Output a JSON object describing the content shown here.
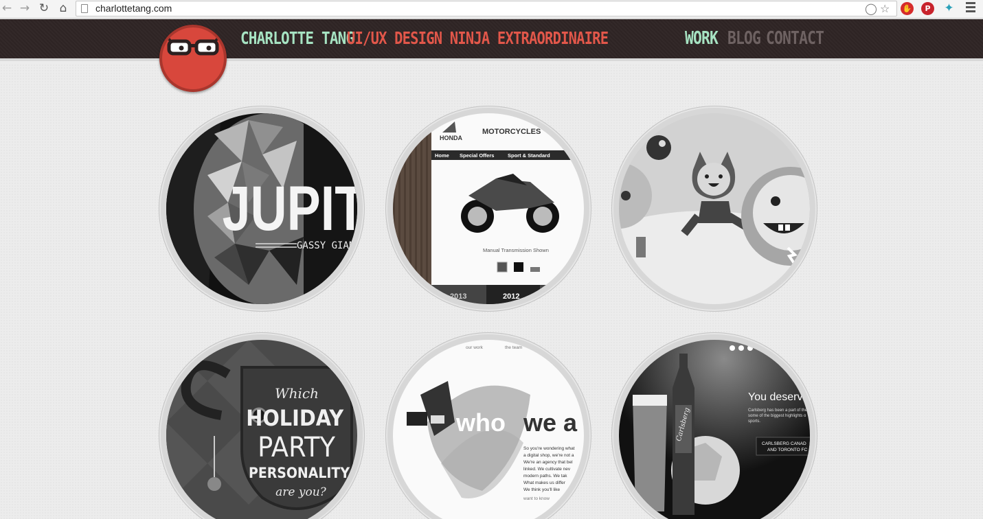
{
  "browser": {
    "url": "charlottetang.com",
    "icons": [
      "back-icon",
      "forward-icon",
      "reload-icon",
      "home-icon",
      "page-icon",
      "shield-icon",
      "star-icon",
      "adblock-icon",
      "pinterest-icon",
      "extension-icon",
      "menu-icon"
    ]
  },
  "header": {
    "brand_name": "CHARLOTTE TANG",
    "tagline": "UI/UX DESIGN NINJA EXTRAORDINAIRE",
    "nav": [
      {
        "label": "WORK",
        "active": true
      },
      {
        "label": "BLOG",
        "active": false
      },
      {
        "label": "CONTACT",
        "active": false
      }
    ]
  },
  "colors": {
    "header_bg": "#2e2424",
    "brand_mint": "#a6e3c2",
    "accent_red": "#e2574a",
    "nav_inactive": "#6e6262",
    "page_bg": "#ececec"
  },
  "portfolio": [
    {
      "name": "jupiter",
      "texts": [
        "JUPIT",
        "GASSY GIANTS"
      ]
    },
    {
      "name": "honda",
      "texts": [
        "HONDA",
        "MOTORCYCLES",
        "Home",
        "Special Offers",
        "Sport & Standard",
        "Manual Transmission Shown",
        "2013",
        "2012"
      ]
    },
    {
      "name": "characters",
      "texts": []
    },
    {
      "name": "holiday-party",
      "texts": [
        "Which",
        "HOLIDAY",
        "PARTY",
        "PERSONALITY",
        "are you?"
      ]
    },
    {
      "name": "who-we-are",
      "texts": [
        "our work",
        "the team",
        "who",
        "we a",
        "So you're wondering what",
        "a digital shop, we're not a",
        "We're an agency that bel",
        "linked. We cultivate nev",
        "modern paths. We tak",
        "What makes us differ",
        "We think you'll like",
        "want to know"
      ]
    },
    {
      "name": "carlsberg",
      "texts": [
        "You deserve",
        "Carlsberg has been a part of the",
        "some of the biggest highlights o",
        "sports.",
        "CARLSBERG CANAD",
        "AND TORONTO FC",
        "Carlsberg"
      ]
    }
  ]
}
